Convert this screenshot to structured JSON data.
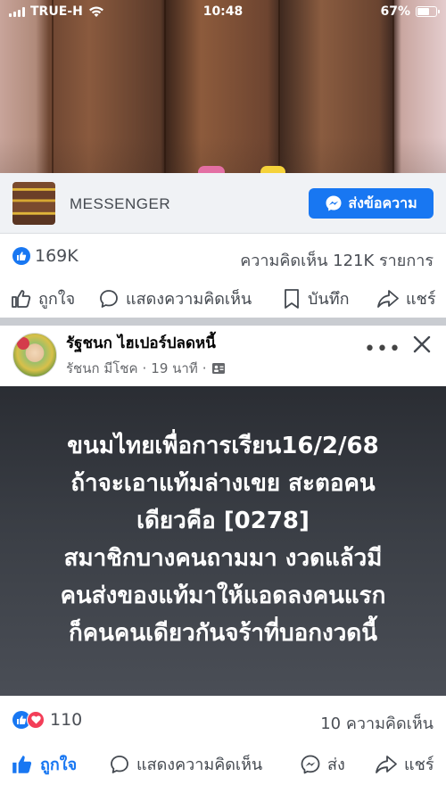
{
  "status_bar": {
    "carrier": "TRUE-H",
    "time": "10:48",
    "battery": "67%",
    "battery_level": 0.67,
    "network_icon": "wifi-icon"
  },
  "media_preview": {
    "sponsor_label": "MESSENGER",
    "send_button": "ส่งข้อความ"
  },
  "post1": {
    "like_count": "169K",
    "comment_summary": "ความคิดเห็น 121K รายการ",
    "actions": {
      "like": "ถูกใจ",
      "comment": "แสดงความคิดเห็น",
      "save": "บันทึก",
      "share": "แชร์"
    }
  },
  "post2": {
    "page_name": "รัฐชนก ไฮเปอร์ปลดหนี้",
    "author": "รัชนก มีโชค",
    "time": "19 นาที",
    "text": "ขนมไทยเพื่อการเรียน16/2/68\nถ้าจะเอาแท้มล่างเขย สะตอคน\nเดียวคือ [0278]\nสมาชิกบางคนถามมา งวดแล้วมี\nคนส่งของแท้มาให้แอดลงคนแรก\nก็คนคนเดียวกันจร้าที่บอกงวดนี้",
    "reaction_count": "110",
    "comment_summary": "10 ความคิดเห็น",
    "actions": {
      "like": "ถูกใจ",
      "comment": "แสดงความคิดเห็น",
      "send": "ส่ง",
      "share": "แชร์"
    }
  },
  "colors": {
    "facebook_blue": "#1877f2",
    "love_red": "#f33e58"
  }
}
